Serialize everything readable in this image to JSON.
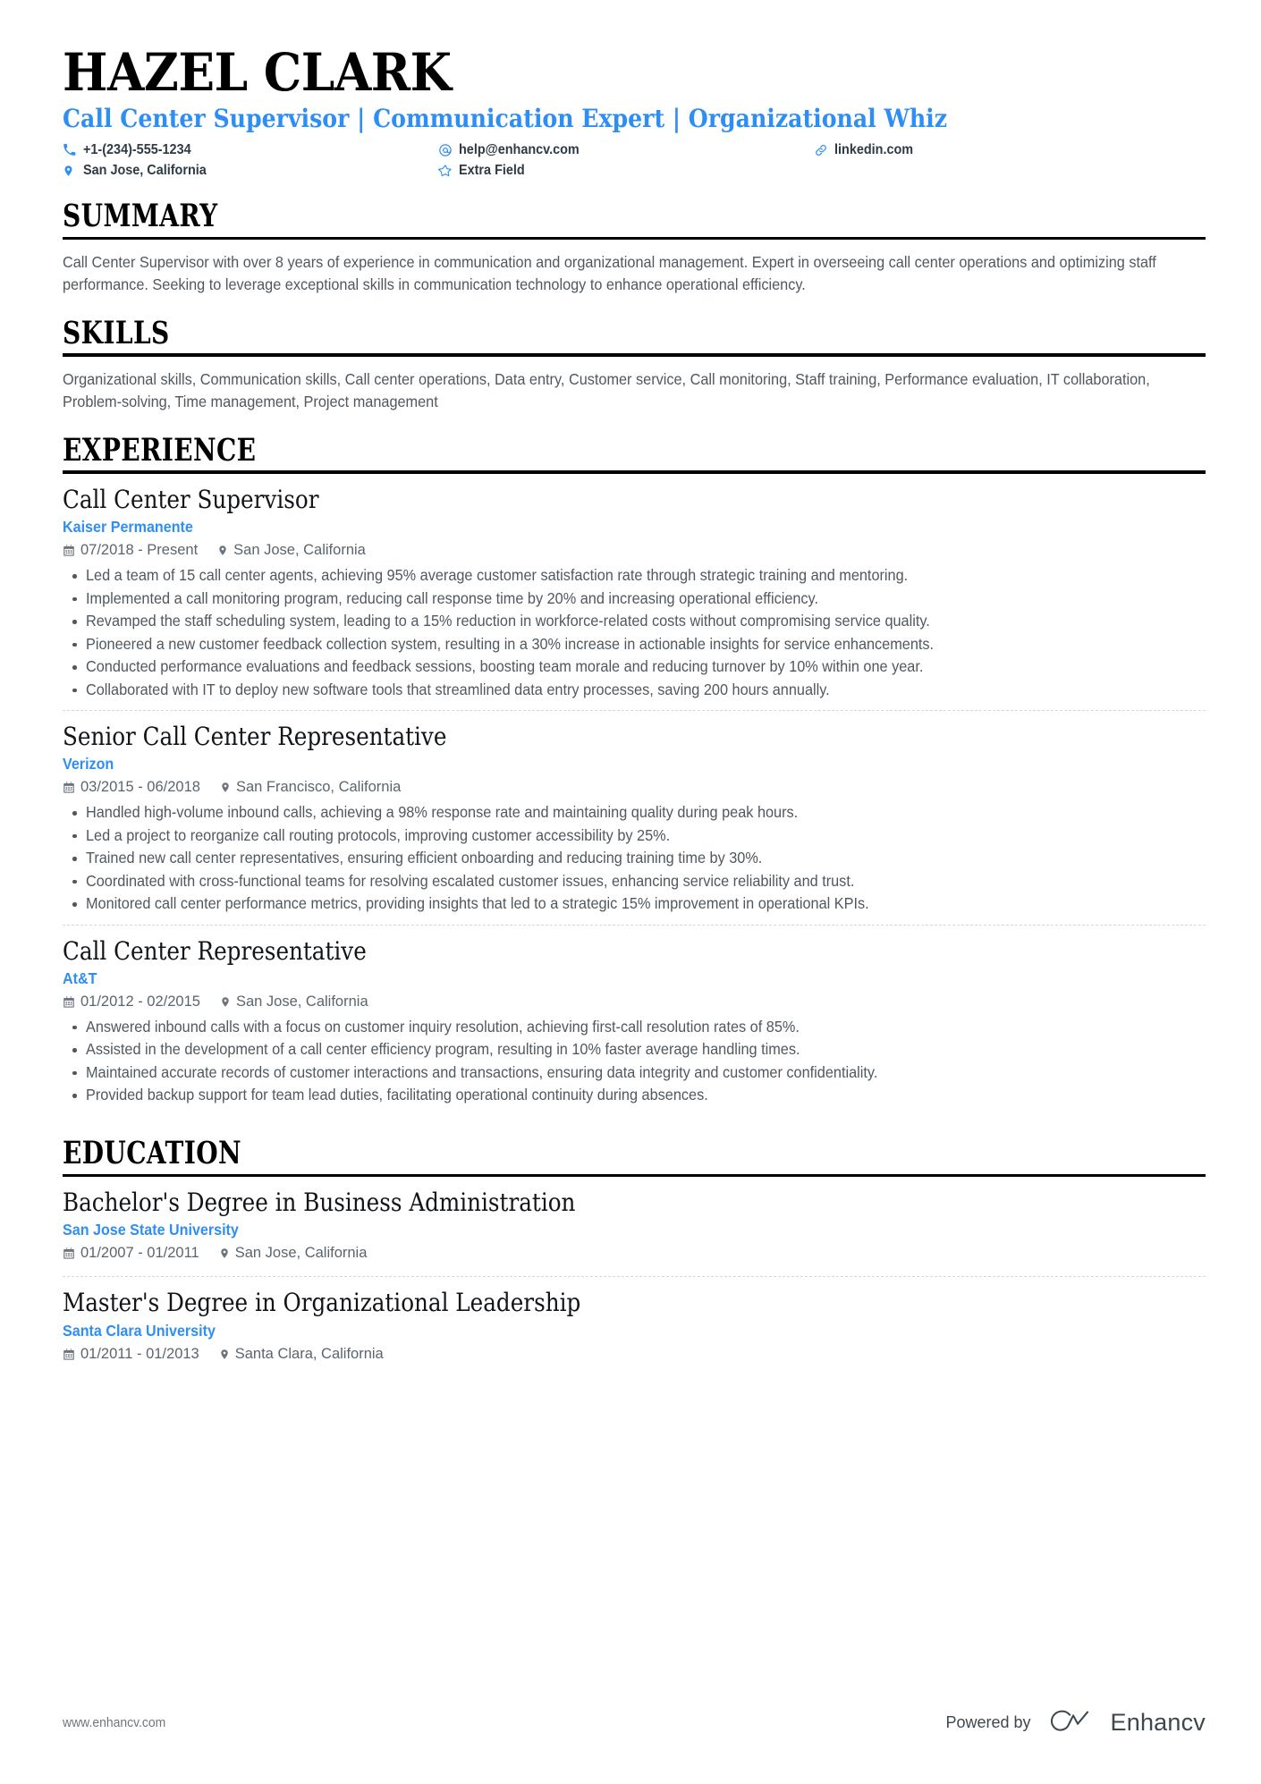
{
  "header": {
    "name": "HAZEL CLARK",
    "headline": "Call Center Supervisor | Communication Expert | Organizational Whiz",
    "accent_color": "#2f8ef4",
    "contacts": [
      {
        "icon": "phone-icon",
        "text": "+1-(234)-555-1234"
      },
      {
        "icon": "email-icon",
        "text": "help@enhancv.com"
      },
      {
        "icon": "link-icon",
        "text": "linkedin.com"
      },
      {
        "icon": "location-pin-icon",
        "text": "San Jose, California"
      },
      {
        "icon": "star-icon",
        "text": "Extra Field"
      }
    ]
  },
  "summary": {
    "title": "SUMMARY",
    "text": "Call Center Supervisor with over 8 years of experience in communication and organizational management. Expert in overseeing call center operations and optimizing staff performance. Seeking to leverage exceptional skills in communication technology to enhance operational efficiency."
  },
  "skills": {
    "title": "SKILLS",
    "text": "Organizational skills, Communication skills, Call center operations, Data entry, Customer service, Call monitoring, Staff training, Performance evaluation, IT collaboration, Problem-solving, Time management, Project management"
  },
  "experience": {
    "title": "EXPERIENCE",
    "entries": [
      {
        "title": "Call Center Supervisor",
        "org": "Kaiser Permanente",
        "dates": "07/2018 - Present",
        "location": "San Jose, California",
        "bullets": [
          "Led a team of 15 call center agents, achieving 95% average customer satisfaction rate through strategic training and mentoring.",
          "Implemented a call monitoring program, reducing call response time by 20% and increasing operational efficiency.",
          "Revamped the staff scheduling system, leading to a 15% reduction in workforce-related costs without compromising service quality.",
          "Pioneered a new customer feedback collection system, resulting in a 30% increase in actionable insights for service enhancements.",
          "Conducted performance evaluations and feedback sessions, boosting team morale and reducing turnover by 10% within one year.",
          "Collaborated with IT to deploy new software tools that streamlined data entry processes, saving 200 hours annually."
        ]
      },
      {
        "title": "Senior Call Center Representative",
        "org": "Verizon",
        "dates": "03/2015 - 06/2018",
        "location": "San Francisco, California",
        "bullets": [
          "Handled high-volume inbound calls, achieving a 98% response rate and maintaining quality during peak hours.",
          "Led a project to reorganize call routing protocols, improving customer accessibility by 25%.",
          "Trained new call center representatives, ensuring efficient onboarding and reducing training time by 30%.",
          "Coordinated with cross-functional teams for resolving escalated customer issues, enhancing service reliability and trust.",
          "Monitored call center performance metrics, providing insights that led to a strategic 15% improvement in operational KPIs."
        ]
      },
      {
        "title": "Call Center Representative",
        "org": "At&T",
        "dates": "01/2012 - 02/2015",
        "location": "San Jose, California",
        "bullets": [
          "Answered inbound calls with a focus on customer inquiry resolution, achieving first-call resolution rates of 85%.",
          "Assisted in the development of a call center efficiency program, resulting in 10% faster average handling times.",
          "Maintained accurate records of customer interactions and transactions, ensuring data integrity and customer confidentiality.",
          "Provided backup support for team lead duties, facilitating operational continuity during absences."
        ]
      }
    ]
  },
  "education": {
    "title": "EDUCATION",
    "entries": [
      {
        "title": "Bachelor's Degree in Business Administration",
        "org": "San Jose State University",
        "dates": "01/2007 - 01/2011",
        "location": "San Jose, California"
      },
      {
        "title": "Master's Degree in Organizational Leadership",
        "org": "Santa Clara University",
        "dates": "01/2011 - 01/2013",
        "location": "Santa Clara, California"
      }
    ]
  },
  "footer": {
    "url": "www.enhancv.com",
    "powered_by": "Powered by",
    "brand": "Enhancv"
  }
}
